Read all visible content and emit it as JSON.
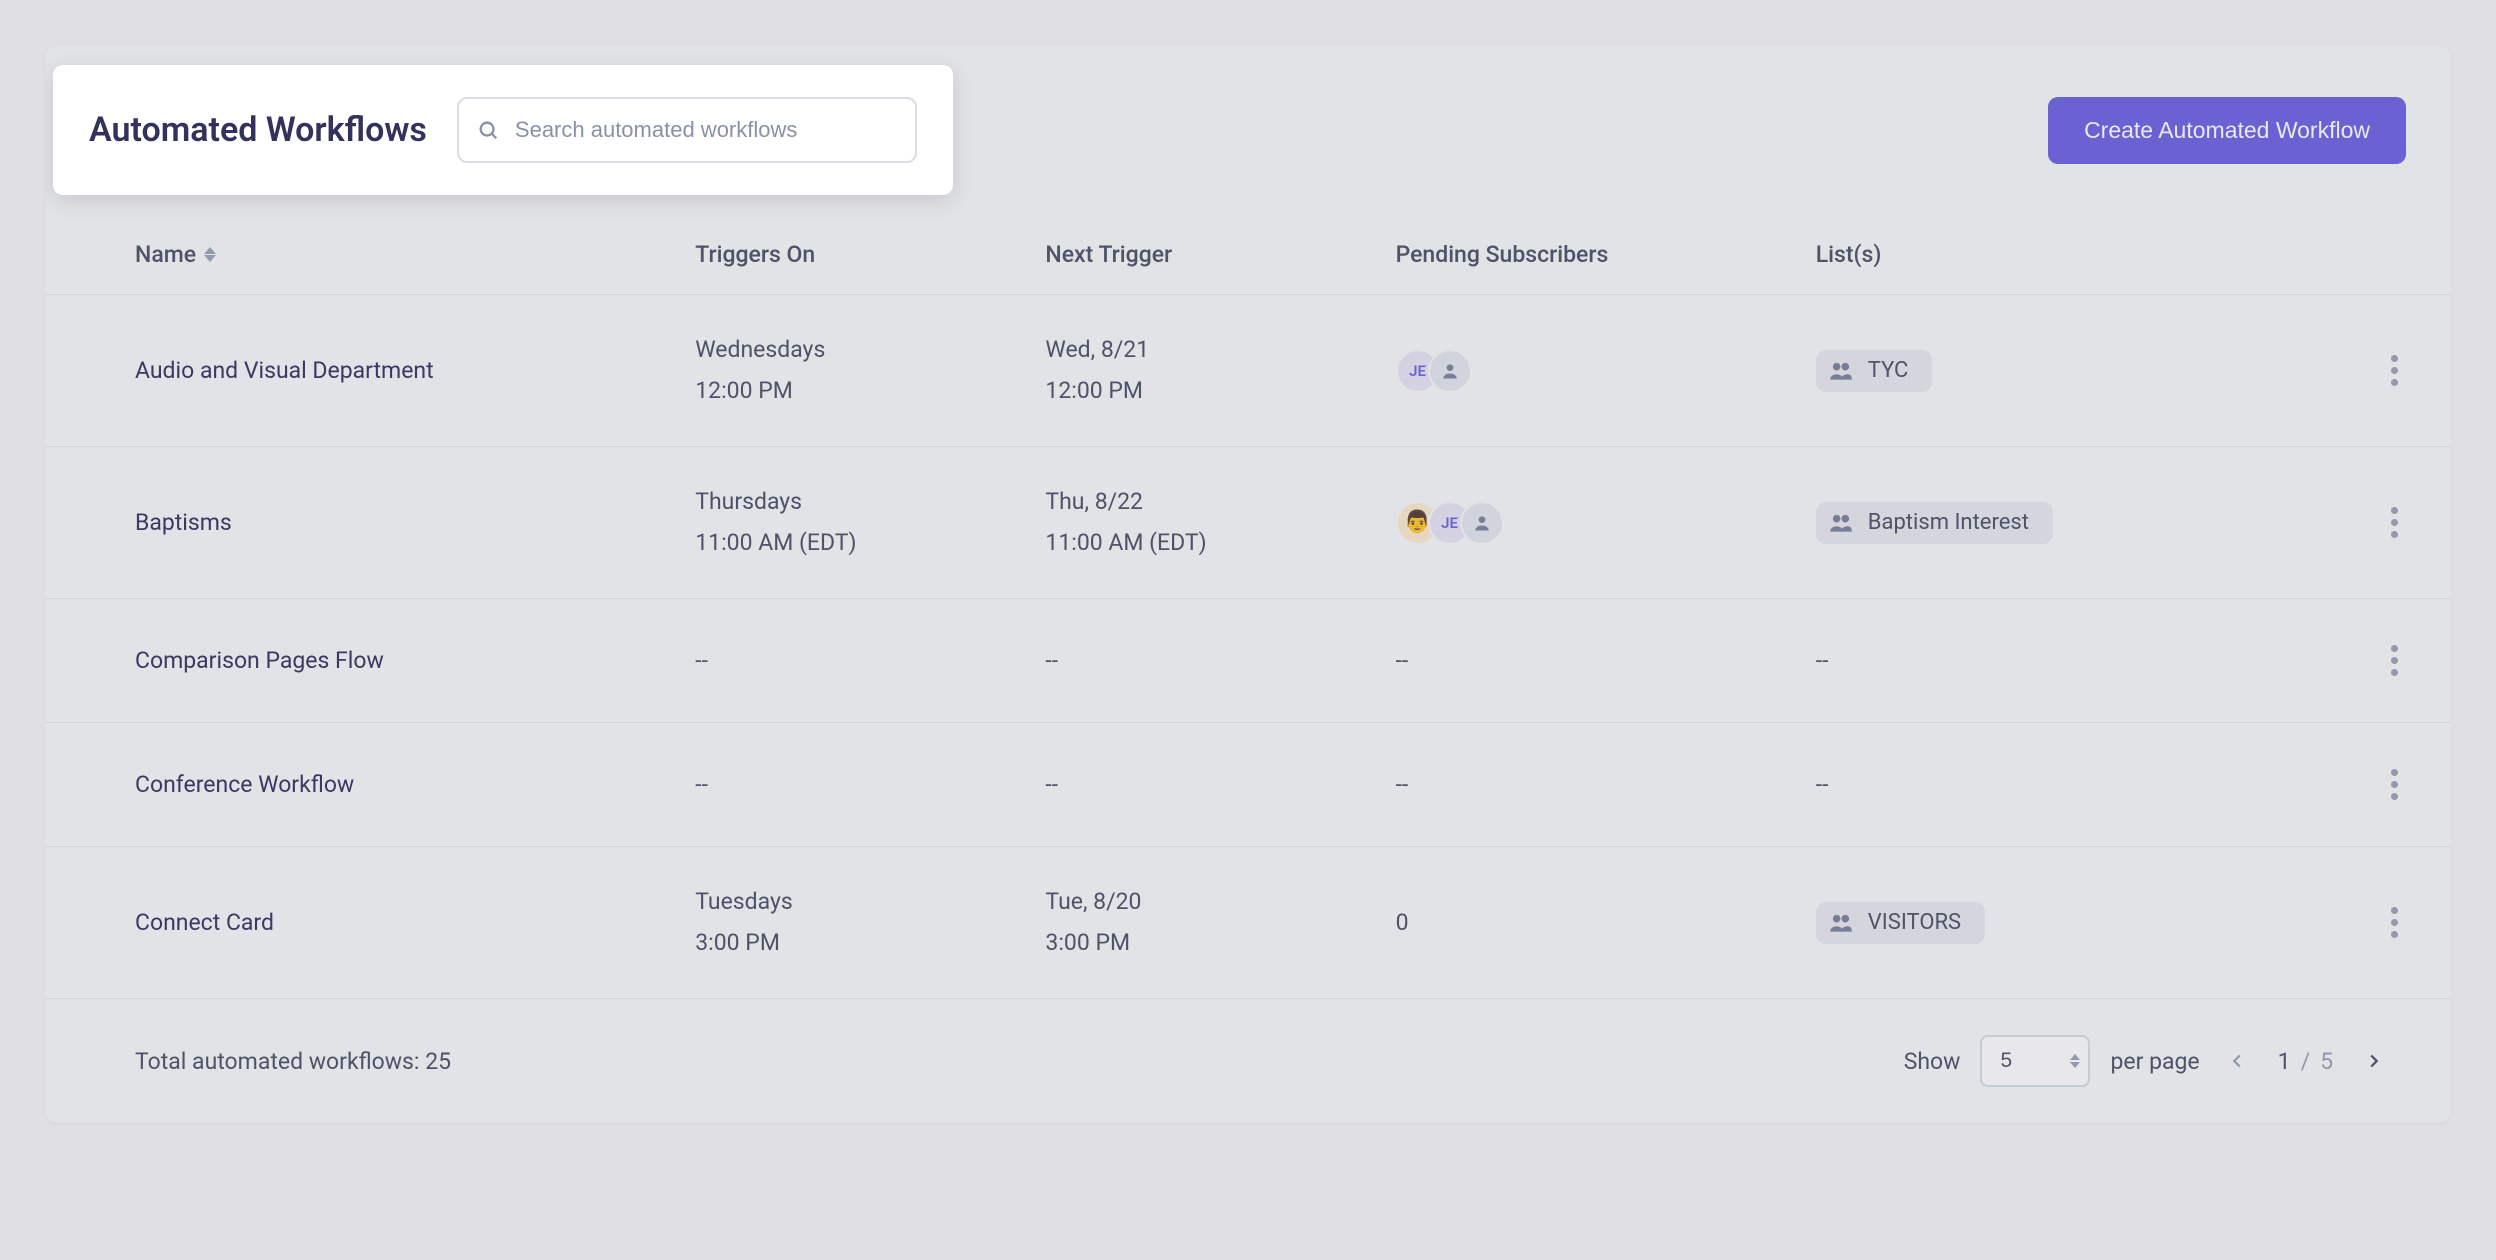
{
  "header": {
    "title": "Automated Workflows",
    "search_placeholder": "Search automated workflows",
    "create_button": "Create Automated Workflow"
  },
  "columns": {
    "name": "Name",
    "triggers": "Triggers On",
    "next_trigger": "Next Trigger",
    "pending": "Pending Subscribers",
    "lists": "List(s)"
  },
  "rows": [
    {
      "name": "Audio and Visual Department",
      "triggers_l1": "Wednesdays",
      "triggers_l2": "12:00 PM",
      "next_l1": "Wed, 8/21",
      "next_l2": "12:00 PM",
      "subscribers": [
        {
          "type": "text",
          "label": "JE"
        },
        {
          "type": "icon"
        }
      ],
      "list": "TYC"
    },
    {
      "name": "Baptisms",
      "triggers_l1": "Thursdays",
      "triggers_l2": "11:00 AM (EDT)",
      "next_l1": "Thu, 8/22",
      "next_l2": "11:00 AM (EDT)",
      "subscribers": [
        {
          "type": "emoji",
          "label": "👨"
        },
        {
          "type": "text",
          "label": "JE"
        },
        {
          "type": "icon"
        }
      ],
      "list": "Baptism Interest"
    },
    {
      "name": "Comparison Pages Flow",
      "triggers_l1": "--",
      "triggers_l2": "",
      "next_l1": "--",
      "next_l2": "",
      "pending_text": "--",
      "list_text": "--"
    },
    {
      "name": "Conference Workflow",
      "triggers_l1": "--",
      "triggers_l2": "",
      "next_l1": "--",
      "next_l2": "",
      "pending_text": "--",
      "list_text": "--"
    },
    {
      "name": "Connect Card",
      "triggers_l1": "Tuesdays",
      "triggers_l2": "3:00 PM",
      "next_l1": "Tue, 8/20",
      "next_l2": "3:00 PM",
      "pending_text": "0",
      "list": "VISITORS"
    }
  ],
  "footer": {
    "total_label": "Total automated workflows: 25",
    "show_label": "Show",
    "per_page_label": "per page",
    "page_size": "5",
    "current_page": "1",
    "divider": "/",
    "total_pages": "5"
  }
}
